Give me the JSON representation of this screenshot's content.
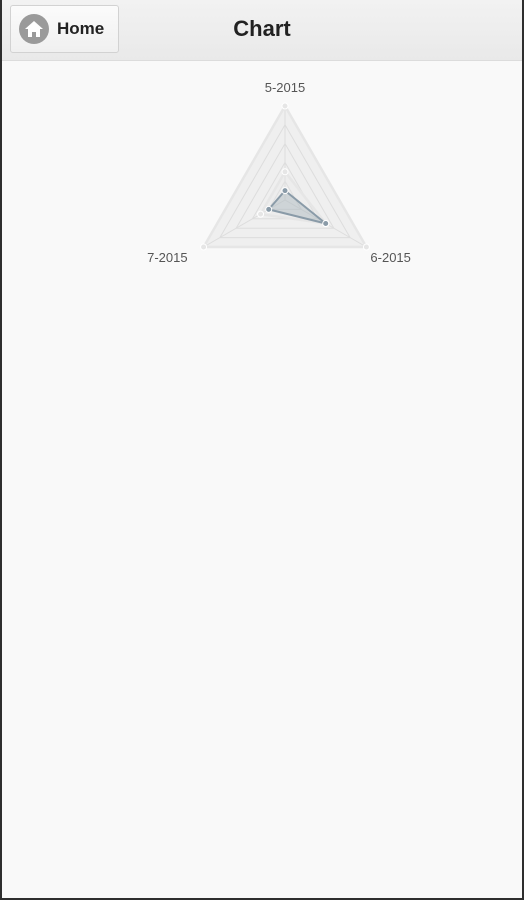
{
  "header": {
    "home_label": "Home",
    "title": "Chart"
  },
  "icons": {
    "home": "home-icon"
  },
  "colors": {
    "series_1_stroke": "#8a9ba8",
    "series_1_fill": "rgba(150,165,175,0.35)",
    "series_2_stroke": "#e6e6e6",
    "series_2_fill": "rgba(220,220,220,0.35)",
    "grid": "#dddddd"
  },
  "chart_data": {
    "type": "radar",
    "categories": [
      "5-2015",
      "6-2015",
      "7-2015"
    ],
    "scale_steps": 5,
    "max": 100,
    "series": [
      {
        "values": [
          100,
          100,
          100
        ]
      },
      {
        "values": [
          30,
          50,
          30
        ]
      },
      {
        "values": [
          10,
          50,
          20
        ]
      }
    ]
  }
}
